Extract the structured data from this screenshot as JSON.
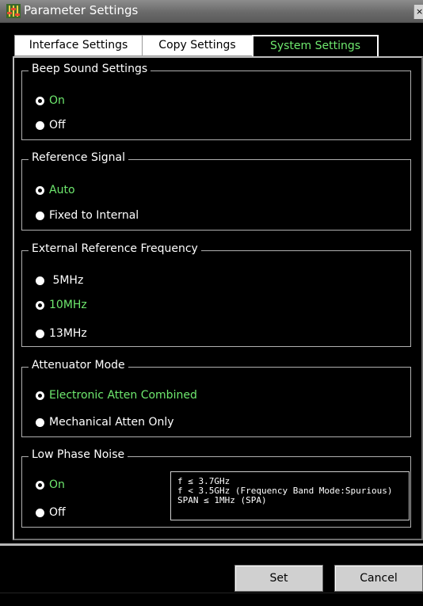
{
  "window": {
    "title": "Parameter Settings",
    "close_glyph": "×"
  },
  "tabs": [
    {
      "label": "Interface Settings",
      "active": false
    },
    {
      "label": "Copy Settings",
      "active": false
    },
    {
      "label": "System Settings",
      "active": true
    }
  ],
  "groups": {
    "beep": {
      "legend": "Beep Sound Settings",
      "options": [
        {
          "label": "On",
          "selected": true
        },
        {
          "label": "Off",
          "selected": false
        }
      ]
    },
    "reference": {
      "legend": "Reference Signal",
      "options": [
        {
          "label": "Auto",
          "selected": true
        },
        {
          "label": "Fixed to Internal",
          "selected": false
        }
      ]
    },
    "ext_freq": {
      "legend": "External Reference Frequency",
      "options": [
        {
          "label": " 5MHz",
          "selected": false
        },
        {
          "label": "10MHz",
          "selected": true
        },
        {
          "label": "13MHz",
          "selected": false
        }
      ]
    },
    "atten": {
      "legend": "Attenuator Mode",
      "options": [
        {
          "label": "Electronic Atten Combined",
          "selected": true
        },
        {
          "label": "Mechanical Atten Only",
          "selected": false
        }
      ]
    },
    "low_phase": {
      "legend": "Low Phase Noise",
      "options": [
        {
          "label": "On",
          "selected": true
        },
        {
          "label": "Off",
          "selected": false
        }
      ],
      "info": [
        "f ≤ 3.7GHz",
        "f < 3.5GHz (Frequency Band Mode:Spurious)",
        "SPAN ≤ 1MHz (SPA)"
      ]
    }
  },
  "buttons": {
    "set": "Set",
    "cancel": "Cancel"
  },
  "colors": {
    "selected_text": "#6ee86e",
    "background": "#000000",
    "titlebar": "#6a6a6a"
  }
}
